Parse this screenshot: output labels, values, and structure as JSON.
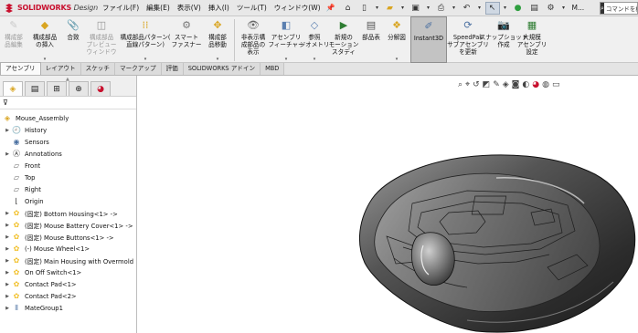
{
  "app": {
    "brand": "SOLIDWORKS",
    "brand_suffix": "Design"
  },
  "menu": [
    "ファイル(F)",
    "編集(E)",
    "表示(V)",
    "挿入(I)",
    "ツール(T)",
    "ウィンドウ(W)"
  ],
  "quick_access": {
    "more_label": "M...",
    "command_search_placeholder": "コマンドを検"
  },
  "ribbon": {
    "buttons": [
      {
        "label": "構成部\n品編集",
        "icon": "edit-component-icon",
        "enabled": false
      },
      {
        "label": "構成部品\nの挿入",
        "icon": "insert-component-icon",
        "enabled": true
      },
      {
        "label": "合致",
        "icon": "mate-icon",
        "enabled": true
      },
      {
        "label": "構成部品\nプレビュー\nウィンドウ",
        "icon": "preview-window-icon",
        "enabled": false
      },
      {
        "label": "構成部品パターン(\n直線パターン)",
        "icon": "linear-pattern-icon",
        "enabled": true
      },
      {
        "label": "スマート\nファスナー",
        "icon": "smart-fastener-icon",
        "enabled": true
      },
      {
        "label": "構成部\n品移動",
        "icon": "move-component-icon",
        "enabled": true
      },
      {
        "label": "非表示構\n成部品の\n表示",
        "icon": "show-hidden-icon",
        "enabled": true
      },
      {
        "label": "アセンブリ\nフィーチャー",
        "icon": "assembly-feature-icon",
        "enabled": true
      },
      {
        "label": "参照\nジオメトリ",
        "icon": "reference-geometry-icon",
        "enabled": true
      },
      {
        "label": "新規の\nモーション\nスタディ",
        "icon": "motion-study-icon",
        "enabled": true
      },
      {
        "label": "部品表",
        "icon": "bom-icon",
        "enabled": true
      },
      {
        "label": "分解図",
        "icon": "exploded-view-icon",
        "enabled": true
      },
      {
        "label": "Instant3D",
        "icon": "instant3d-icon",
        "enabled": true,
        "active": true
      },
      {
        "label": "SpeedPak\nサブアセンブリ\nを更新",
        "icon": "speedpak-icon",
        "enabled": true
      },
      {
        "label": "スナップショット\n作成",
        "icon": "snapshot-icon",
        "enabled": true
      },
      {
        "label": "大規模\nアセンブリ\n設定",
        "icon": "large-assembly-icon",
        "enabled": true
      }
    ]
  },
  "tabs": [
    {
      "label": "アセンブリ",
      "active": true
    },
    {
      "label": "レイアウト",
      "active": false
    },
    {
      "label": "スケッチ",
      "active": false
    },
    {
      "label": "マークアップ",
      "active": false
    },
    {
      "label": "評価",
      "active": false
    },
    {
      "label": "SOLIDWORKS アドイン",
      "active": false
    },
    {
      "label": "MBD",
      "active": false
    }
  ],
  "feature_tree": {
    "root": "Mouse_Assembly",
    "items": [
      {
        "label": "History",
        "icon": "history-icon",
        "expandable": true
      },
      {
        "label": "Sensors",
        "icon": "sensor-icon",
        "expandable": false
      },
      {
        "label": "Annotations",
        "icon": "annotations-icon",
        "expandable": true
      },
      {
        "label": "Front",
        "icon": "plane-icon",
        "expandable": false
      },
      {
        "label": "Top",
        "icon": "plane-icon",
        "expandable": false
      },
      {
        "label": "Right",
        "icon": "plane-icon",
        "expandable": false
      },
      {
        "label": "Origin",
        "icon": "origin-icon",
        "expandable": false
      },
      {
        "label": "(固定) Bottom Housing<1> ->",
        "icon": "part-icon",
        "expandable": true
      },
      {
        "label": "(固定) Mouse Battery Cover<1> ->",
        "icon": "part-icon",
        "expandable": true
      },
      {
        "label": "(固定) Mouse Buttons<1> ->",
        "icon": "part-icon",
        "expandable": true
      },
      {
        "label": "(-) Mouse Wheel<1>",
        "icon": "part-icon",
        "expandable": true
      },
      {
        "label": "(固定) Main Housing with Overmold",
        "icon": "part-icon",
        "expandable": true
      },
      {
        "label": "On Off Switch<1>",
        "icon": "part-icon",
        "expandable": true
      },
      {
        "label": "Contact Pad<1>",
        "icon": "part-icon",
        "expandable": true
      },
      {
        "label": "Contact Pad<2>",
        "icon": "part-icon",
        "expandable": true
      },
      {
        "label": "MateGroup1",
        "icon": "mategroup-icon",
        "expandable": true
      }
    ]
  },
  "colors": {
    "brand_red": "#c8102e",
    "ribbon_bg": "#f0f0f0",
    "active_button_bg": "#c3c3c3",
    "part_icon": "#f2c230",
    "model_body": "#3c3c3c"
  }
}
